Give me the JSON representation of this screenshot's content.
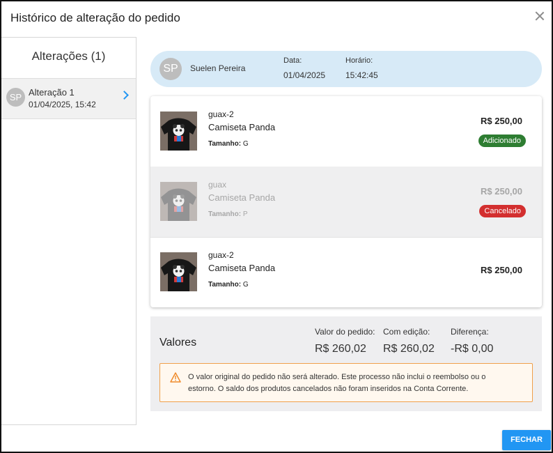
{
  "dialog": {
    "title": "Histórico de alteração do pedido"
  },
  "sidebar": {
    "heading": "Alterações (1)",
    "items": [
      {
        "initials": "SP",
        "title": "Alteração 1",
        "datetime": "01/04/2025, 15:42"
      }
    ]
  },
  "change_header": {
    "initials": "SP",
    "user_name": "Suelen Pereira",
    "date_label": "Data:",
    "date": "01/04/2025",
    "time_label": "Horário:",
    "time": "15:42:45"
  },
  "products": [
    {
      "sku": "guax-2",
      "name": "Camiseta Panda",
      "size_label": "Tamanho:",
      "size": "G",
      "price": "R$ 250,00",
      "badge": "Adicionado",
      "status": "added"
    },
    {
      "sku": "guax",
      "name": "Camiseta Panda",
      "size_label": "Tamanho:",
      "size": "P",
      "price": "R$ 250,00",
      "badge": "Cancelado",
      "status": "cancelled"
    },
    {
      "sku": "guax-2",
      "name": "Camiseta Panda",
      "size_label": "Tamanho:",
      "size": "G",
      "price": "R$ 250,00",
      "badge": "",
      "status": "unchanged"
    }
  ],
  "summary": {
    "title": "Valores",
    "order_value_label": "Valor do pedido:",
    "order_value": "R$ 260,02",
    "edited_value_label": "Com edição:",
    "edited_value": "R$ 260,02",
    "difference_label": "Diferença:",
    "difference": "-R$ 0,00",
    "warning": "O valor original do pedido não será alterado. Este processo não inclui o reembolso ou o estorno. O saldo dos produtos cancelados não foram inseridos na Conta Corrente."
  },
  "actions": {
    "close_label": "FECHAR"
  },
  "colors": {
    "accent": "#2196f3",
    "added": "#2e7d32",
    "cancelled": "#d32f2f",
    "warning_border": "#f0a04b",
    "pill_bg": "#d7eaf7"
  },
  "icons": {
    "close": "close-icon",
    "chevron": "chevron-right-icon",
    "warning": "warning-triangle-icon",
    "product": "panda-tshirt-thumbnail"
  }
}
